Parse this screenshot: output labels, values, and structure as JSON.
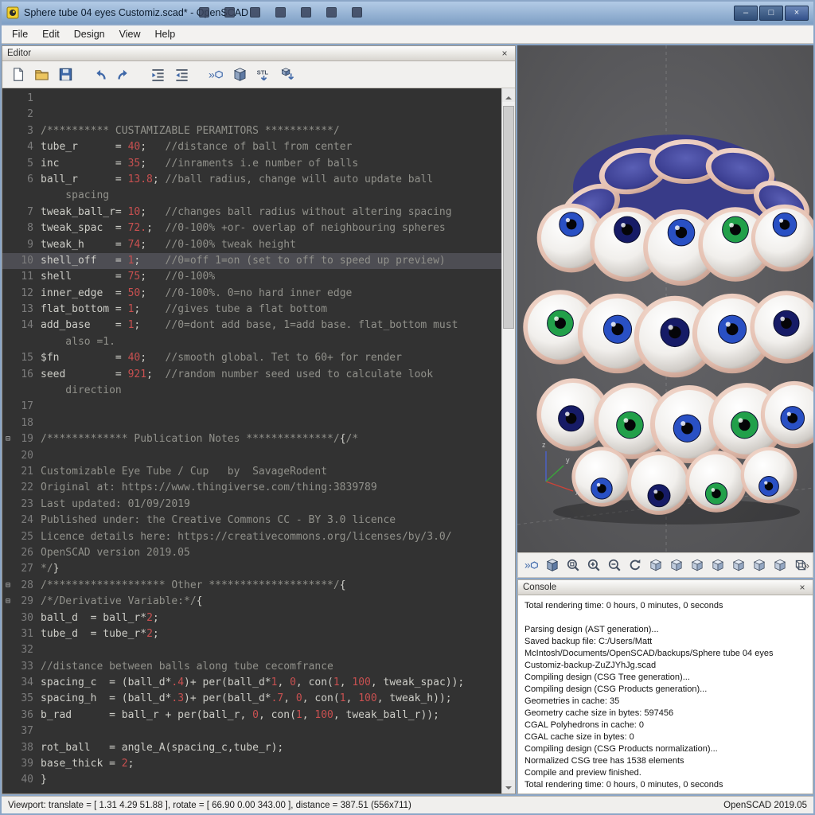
{
  "window": {
    "title": "Sphere tube 04 eyes Customiz.scad* - OpenSCAD",
    "controls": {
      "minimize": "–",
      "maximize": "□",
      "close": "×"
    }
  },
  "titlebar": {
    "badge_icons": [
      "window-icon",
      "window-icon",
      "window-icon",
      "window-icon",
      "window-icon",
      "window-icon",
      "window-icon"
    ]
  },
  "menu": {
    "items": [
      "File",
      "Edit",
      "Design",
      "View",
      "Help"
    ]
  },
  "editor": {
    "panel_title": "Editor",
    "close_glyph": "×",
    "toolbar": {
      "icons": [
        "new-file",
        "open-file",
        "save-file",
        "undo",
        "redo",
        "indent",
        "unindent",
        "preview",
        "render",
        "export-stl",
        "export-image"
      ]
    },
    "code": {
      "rows": [
        {
          "n": "1",
          "seg": []
        },
        {
          "n": "2",
          "seg": []
        },
        {
          "n": "3",
          "seg": [
            [
              "com",
              "/********** CUSTAMIZABLE PERAMITORS ***********/"
            ]
          ]
        },
        {
          "n": "4",
          "seg": [
            [
              "p",
              "tube_r      = "
            ],
            [
              "num",
              "40"
            ],
            [
              "p",
              ";"
            ],
            [
              "com",
              "   //distance of ball from center"
            ]
          ]
        },
        {
          "n": "5",
          "seg": [
            [
              "p",
              "inc         = "
            ],
            [
              "num",
              "35"
            ],
            [
              "p",
              ";"
            ],
            [
              "com",
              "   //inraments i.e number of balls"
            ]
          ]
        },
        {
          "n": "6",
          "seg": [
            [
              "p",
              "ball_r      = "
            ],
            [
              "num",
              "13.8"
            ],
            [
              "p",
              ";"
            ],
            [
              "com",
              " //ball radius, change will auto update ball"
            ]
          ]
        },
        {
          "n": "",
          "seg": [
            [
              "com",
              "    spacing"
            ]
          ]
        },
        {
          "n": "7",
          "seg": [
            [
              "p",
              "tweak_ball_r= "
            ],
            [
              "num",
              "10"
            ],
            [
              "p",
              ";"
            ],
            [
              "com",
              "   //changes ball radius without altering spacing"
            ]
          ]
        },
        {
          "n": "8",
          "seg": [
            [
              "p",
              "tweak_spac  = "
            ],
            [
              "num",
              "72."
            ],
            [
              "p",
              ";"
            ],
            [
              "com",
              "  //0-100% +or- overlap of neighbouring spheres"
            ]
          ]
        },
        {
          "n": "9",
          "seg": [
            [
              "p",
              "tweak_h     = "
            ],
            [
              "num",
              "74"
            ],
            [
              "p",
              ";"
            ],
            [
              "com",
              "   //0-100% tweak height"
            ]
          ]
        },
        {
          "n": "10",
          "hl": true,
          "seg": [
            [
              "p",
              "shell_off   = "
            ],
            [
              "num",
              "1"
            ],
            [
              "p",
              ";"
            ],
            [
              "com",
              "    //0=off 1=on (set to off to speed up preview)"
            ]
          ]
        },
        {
          "n": "11",
          "seg": [
            [
              "p",
              "shell       = "
            ],
            [
              "num",
              "75"
            ],
            [
              "p",
              ";"
            ],
            [
              "com",
              "   //0-100%"
            ]
          ]
        },
        {
          "n": "12",
          "seg": [
            [
              "p",
              "inner_edge  = "
            ],
            [
              "num",
              "50"
            ],
            [
              "p",
              ";"
            ],
            [
              "com",
              "   //0-100%. 0=no hard inner edge"
            ]
          ]
        },
        {
          "n": "13",
          "seg": [
            [
              "p",
              "flat_bottom = "
            ],
            [
              "num",
              "1"
            ],
            [
              "p",
              ";"
            ],
            [
              "com",
              "    //gives tube a flat bottom"
            ]
          ]
        },
        {
          "n": "14",
          "seg": [
            [
              "p",
              "add_base    = "
            ],
            [
              "num",
              "1"
            ],
            [
              "p",
              ";"
            ],
            [
              "com",
              "    //0=dont add base, 1=add base. flat_bottom must"
            ]
          ]
        },
        {
          "n": "",
          "seg": [
            [
              "com",
              "    also =1."
            ]
          ]
        },
        {
          "n": "15",
          "seg": [
            [
              "p",
              "$fn         = "
            ],
            [
              "num",
              "40"
            ],
            [
              "p",
              ";"
            ],
            [
              "com",
              "   //smooth global. Tet to 60+ for render"
            ]
          ]
        },
        {
          "n": "16",
          "seg": [
            [
              "p",
              "seed        = "
            ],
            [
              "num",
              "921"
            ],
            [
              "p",
              ";"
            ],
            [
              "com",
              "  //random number seed used to calculate look"
            ]
          ]
        },
        {
          "n": "",
          "seg": [
            [
              "com",
              "    direction"
            ]
          ]
        },
        {
          "n": "17",
          "seg": []
        },
        {
          "n": "18",
          "seg": []
        },
        {
          "n": "19",
          "fold": true,
          "seg": [
            [
              "com",
              "/************* Publication Notes **************/"
            ],
            [
              "p",
              "{"
            ],
            [
              "com",
              "/*"
            ]
          ]
        },
        {
          "n": "20",
          "seg": []
        },
        {
          "n": "21",
          "seg": [
            [
              "com",
              "Customizable Eye Tube / Cup   by  SavageRodent"
            ]
          ]
        },
        {
          "n": "22",
          "seg": [
            [
              "com",
              "Original at: https://www.thingiverse.com/thing:3839789"
            ]
          ]
        },
        {
          "n": "23",
          "seg": [
            [
              "com",
              "Last updated: 01/09/2019"
            ]
          ]
        },
        {
          "n": "24",
          "seg": [
            [
              "com",
              "Published under: the Creative Commons CC - BY 3.0 licence"
            ]
          ]
        },
        {
          "n": "25",
          "seg": [
            [
              "com",
              "Licence details here: https://creativecommons.org/licenses/by/3.0/"
            ]
          ]
        },
        {
          "n": "26",
          "seg": [
            [
              "com",
              "OpenSCAD version 2019.05"
            ]
          ]
        },
        {
          "n": "27",
          "seg": [
            [
              "com",
              "*/"
            ],
            [
              "p",
              "}"
            ]
          ]
        },
        {
          "n": "28",
          "fold": true,
          "seg": [
            [
              "com",
              "/******************* Other ********************/"
            ],
            [
              "p",
              "{"
            ]
          ]
        },
        {
          "n": "29",
          "fold": true,
          "seg": [
            [
              "com",
              "/*/Derivative Variable:*/"
            ],
            [
              "p",
              "{"
            ]
          ]
        },
        {
          "n": "30",
          "seg": [
            [
              "p",
              "ball_d  = ball_r*"
            ],
            [
              "num",
              "2"
            ],
            [
              "p",
              ";"
            ]
          ]
        },
        {
          "n": "31",
          "seg": [
            [
              "p",
              "tube_d  = tube_r*"
            ],
            [
              "num",
              "2"
            ],
            [
              "p",
              ";"
            ]
          ]
        },
        {
          "n": "32",
          "seg": []
        },
        {
          "n": "33",
          "seg": [
            [
              "com",
              "//distance between balls along tube cecomfrance"
            ]
          ]
        },
        {
          "n": "34",
          "seg": [
            [
              "p",
              "spacing_c  = (ball_d*"
            ],
            [
              "num",
              ".4"
            ],
            [
              "p",
              ")+ per(ball_d*"
            ],
            [
              "num",
              "1"
            ],
            [
              "p",
              ", "
            ],
            [
              "num",
              "0"
            ],
            [
              "p",
              ", con("
            ],
            [
              "num",
              "1"
            ],
            [
              "p",
              ", "
            ],
            [
              "num",
              "100"
            ],
            [
              "p",
              ", tweak_spac));"
            ]
          ]
        },
        {
          "n": "35",
          "seg": [
            [
              "p",
              "spacing_h  = (ball_d*"
            ],
            [
              "num",
              ".3"
            ],
            [
              "p",
              ")+ per(ball_d*"
            ],
            [
              "num",
              ".7"
            ],
            [
              "p",
              ", "
            ],
            [
              "num",
              "0"
            ],
            [
              "p",
              ", con("
            ],
            [
              "num",
              "1"
            ],
            [
              "p",
              ", "
            ],
            [
              "num",
              "100"
            ],
            [
              "p",
              ", tweak_h));"
            ]
          ]
        },
        {
          "n": "36",
          "seg": [
            [
              "p",
              "b_rad      = ball_r + per(ball_r, "
            ],
            [
              "num",
              "0"
            ],
            [
              "p",
              ", con("
            ],
            [
              "num",
              "1"
            ],
            [
              "p",
              ", "
            ],
            [
              "num",
              "100"
            ],
            [
              "p",
              ", tweak_ball_r));"
            ]
          ]
        },
        {
          "n": "37",
          "seg": []
        },
        {
          "n": "38",
          "seg": [
            [
              "p",
              "rot_ball   = angle_A(spacing_c,tube_r);"
            ]
          ]
        },
        {
          "n": "39",
          "seg": [
            [
              "p",
              "base_thick = "
            ],
            [
              "num",
              "2"
            ],
            [
              "p",
              ";"
            ]
          ]
        },
        {
          "n": "40",
          "seg": [
            [
              "p",
              "}"
            ]
          ]
        }
      ]
    }
  },
  "viewport": {
    "axis": {
      "x": "x",
      "y": "y",
      "z": "z"
    },
    "overflow_glyph": "»",
    "toolbar": {
      "icons": [
        "preview",
        "render",
        "zoom-all",
        "zoom-in",
        "zoom-out",
        "reset-view",
        "view-right",
        "view-top",
        "view-bottom",
        "view-left",
        "view-front",
        "view-back",
        "view-diagonal",
        "perspective"
      ]
    },
    "model": {
      "background": "#57575a",
      "shell": "#e4bfb0",
      "sclera": "#f4f2ef",
      "iris_blue": "#2950c4",
      "iris_green": "#22a04a",
      "iris_navy": "#161b66",
      "interior_blue": "#3c3f92"
    }
  },
  "console": {
    "panel_title": "Console",
    "close_glyph": "×",
    "lines": [
      "Total rendering time: 0 hours, 0 minutes, 0 seconds",
      "",
      "Parsing design (AST generation)...",
      "Saved backup file: C:/Users/Matt McIntosh/Documents/OpenSCAD/backups/Sphere tube 04 eyes Customiz-backup-ZuZJYhJg.scad",
      "Compiling design (CSG Tree generation)...",
      "Compiling design (CSG Products generation)...",
      "Geometries in cache: 35",
      "Geometry cache size in bytes: 597456",
      "CGAL Polyhedrons in cache: 0",
      "CGAL cache size in bytes: 0",
      "Compiling design (CSG Products normalization)...",
      "Normalized CSG tree has 1538 elements",
      "Compile and preview finished.",
      "Total rendering time: 0 hours, 0 minutes, 0 seconds"
    ]
  },
  "status_bar": {
    "left": "Viewport: translate = [ 1.31 4.29 51.88 ], rotate = [ 66.90 0.00 343.00 ], distance = 387.51 (556x711)",
    "right": "OpenSCAD 2019.05"
  }
}
